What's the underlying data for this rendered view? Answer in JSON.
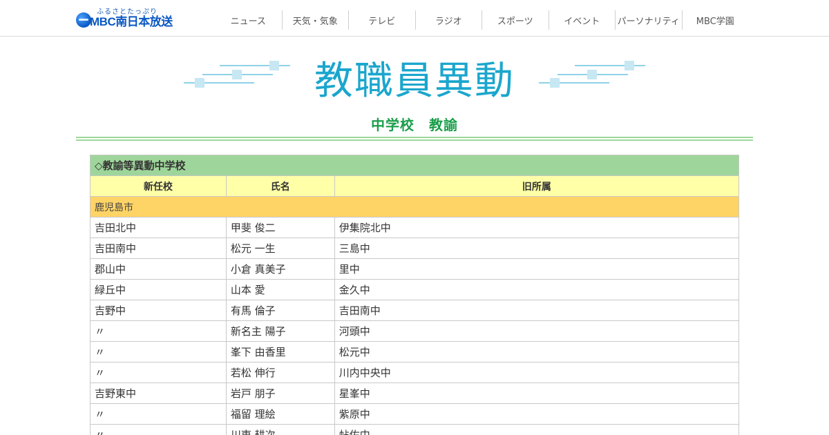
{
  "header": {
    "logo_kana": "ふるさとたっぷり",
    "logo_name": "MBC南日本放送",
    "nav": [
      "ニュース",
      "天気・気象",
      "テレビ",
      "ラジオ",
      "スポーツ",
      "イベント",
      "パーソナリティ",
      "MBC学園"
    ]
  },
  "banner": {
    "title": "教職員異動"
  },
  "section": {
    "title": "中学校　教諭"
  },
  "table": {
    "caption": "◇教諭等異動中学校",
    "headers": [
      "新任校",
      "氏名",
      "旧所属"
    ],
    "region": "鹿児島市",
    "rows": [
      [
        "吉田北中",
        "甲斐 俊二",
        "伊集院北中"
      ],
      [
        "吉田南中",
        "松元 一生",
        "三島中"
      ],
      [
        "郡山中",
        "小倉 真美子",
        "里中"
      ],
      [
        "緑丘中",
        "山本 愛",
        "金久中"
      ],
      [
        "吉野中",
        "有馬 倫子",
        "吉田南中"
      ],
      [
        "〃",
        "新名主 陽子",
        "河頭中"
      ],
      [
        "〃",
        "峯下 由香里",
        "松元中"
      ],
      [
        "〃",
        "若松 伸行",
        "川内中央中"
      ],
      [
        "吉野東中",
        "岩戸 朋子",
        "星峯中"
      ],
      [
        "〃",
        "福留 理絵",
        "紫原中"
      ],
      [
        "〃",
        "川東 耕次",
        "帖佐中"
      ]
    ]
  },
  "colors": {
    "accent_blue": "#1ba6cd",
    "section_green": "#1a9e4a",
    "caption_bg": "#9ed59a",
    "header_bg": "#ffffa8",
    "region_bg": "#ffd466"
  }
}
